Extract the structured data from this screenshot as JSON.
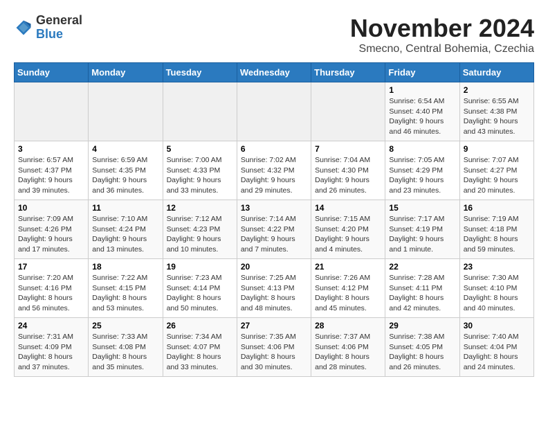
{
  "logo": {
    "general": "General",
    "blue": "Blue"
  },
  "title": "November 2024",
  "subtitle": "Smecno, Central Bohemia, Czechia",
  "weekdays": [
    "Sunday",
    "Monday",
    "Tuesday",
    "Wednesday",
    "Thursday",
    "Friday",
    "Saturday"
  ],
  "weeks": [
    [
      {
        "day": "",
        "info": ""
      },
      {
        "day": "",
        "info": ""
      },
      {
        "day": "",
        "info": ""
      },
      {
        "day": "",
        "info": ""
      },
      {
        "day": "",
        "info": ""
      },
      {
        "day": "1",
        "info": "Sunrise: 6:54 AM\nSunset: 4:40 PM\nDaylight: 9 hours\nand 46 minutes."
      },
      {
        "day": "2",
        "info": "Sunrise: 6:55 AM\nSunset: 4:38 PM\nDaylight: 9 hours\nand 43 minutes."
      }
    ],
    [
      {
        "day": "3",
        "info": "Sunrise: 6:57 AM\nSunset: 4:37 PM\nDaylight: 9 hours\nand 39 minutes."
      },
      {
        "day": "4",
        "info": "Sunrise: 6:59 AM\nSunset: 4:35 PM\nDaylight: 9 hours\nand 36 minutes."
      },
      {
        "day": "5",
        "info": "Sunrise: 7:00 AM\nSunset: 4:33 PM\nDaylight: 9 hours\nand 33 minutes."
      },
      {
        "day": "6",
        "info": "Sunrise: 7:02 AM\nSunset: 4:32 PM\nDaylight: 9 hours\nand 29 minutes."
      },
      {
        "day": "7",
        "info": "Sunrise: 7:04 AM\nSunset: 4:30 PM\nDaylight: 9 hours\nand 26 minutes."
      },
      {
        "day": "8",
        "info": "Sunrise: 7:05 AM\nSunset: 4:29 PM\nDaylight: 9 hours\nand 23 minutes."
      },
      {
        "day": "9",
        "info": "Sunrise: 7:07 AM\nSunset: 4:27 PM\nDaylight: 9 hours\nand 20 minutes."
      }
    ],
    [
      {
        "day": "10",
        "info": "Sunrise: 7:09 AM\nSunset: 4:26 PM\nDaylight: 9 hours\nand 17 minutes."
      },
      {
        "day": "11",
        "info": "Sunrise: 7:10 AM\nSunset: 4:24 PM\nDaylight: 9 hours\nand 13 minutes."
      },
      {
        "day": "12",
        "info": "Sunrise: 7:12 AM\nSunset: 4:23 PM\nDaylight: 9 hours\nand 10 minutes."
      },
      {
        "day": "13",
        "info": "Sunrise: 7:14 AM\nSunset: 4:22 PM\nDaylight: 9 hours\nand 7 minutes."
      },
      {
        "day": "14",
        "info": "Sunrise: 7:15 AM\nSunset: 4:20 PM\nDaylight: 9 hours\nand 4 minutes."
      },
      {
        "day": "15",
        "info": "Sunrise: 7:17 AM\nSunset: 4:19 PM\nDaylight: 9 hours\nand 1 minute."
      },
      {
        "day": "16",
        "info": "Sunrise: 7:19 AM\nSunset: 4:18 PM\nDaylight: 8 hours\nand 59 minutes."
      }
    ],
    [
      {
        "day": "17",
        "info": "Sunrise: 7:20 AM\nSunset: 4:16 PM\nDaylight: 8 hours\nand 56 minutes."
      },
      {
        "day": "18",
        "info": "Sunrise: 7:22 AM\nSunset: 4:15 PM\nDaylight: 8 hours\nand 53 minutes."
      },
      {
        "day": "19",
        "info": "Sunrise: 7:23 AM\nSunset: 4:14 PM\nDaylight: 8 hours\nand 50 minutes."
      },
      {
        "day": "20",
        "info": "Sunrise: 7:25 AM\nSunset: 4:13 PM\nDaylight: 8 hours\nand 48 minutes."
      },
      {
        "day": "21",
        "info": "Sunrise: 7:26 AM\nSunset: 4:12 PM\nDaylight: 8 hours\nand 45 minutes."
      },
      {
        "day": "22",
        "info": "Sunrise: 7:28 AM\nSunset: 4:11 PM\nDaylight: 8 hours\nand 42 minutes."
      },
      {
        "day": "23",
        "info": "Sunrise: 7:30 AM\nSunset: 4:10 PM\nDaylight: 8 hours\nand 40 minutes."
      }
    ],
    [
      {
        "day": "24",
        "info": "Sunrise: 7:31 AM\nSunset: 4:09 PM\nDaylight: 8 hours\nand 37 minutes."
      },
      {
        "day": "25",
        "info": "Sunrise: 7:33 AM\nSunset: 4:08 PM\nDaylight: 8 hours\nand 35 minutes."
      },
      {
        "day": "26",
        "info": "Sunrise: 7:34 AM\nSunset: 4:07 PM\nDaylight: 8 hours\nand 33 minutes."
      },
      {
        "day": "27",
        "info": "Sunrise: 7:35 AM\nSunset: 4:06 PM\nDaylight: 8 hours\nand 30 minutes."
      },
      {
        "day": "28",
        "info": "Sunrise: 7:37 AM\nSunset: 4:06 PM\nDaylight: 8 hours\nand 28 minutes."
      },
      {
        "day": "29",
        "info": "Sunrise: 7:38 AM\nSunset: 4:05 PM\nDaylight: 8 hours\nand 26 minutes."
      },
      {
        "day": "30",
        "info": "Sunrise: 7:40 AM\nSunset: 4:04 PM\nDaylight: 8 hours\nand 24 minutes."
      }
    ]
  ]
}
